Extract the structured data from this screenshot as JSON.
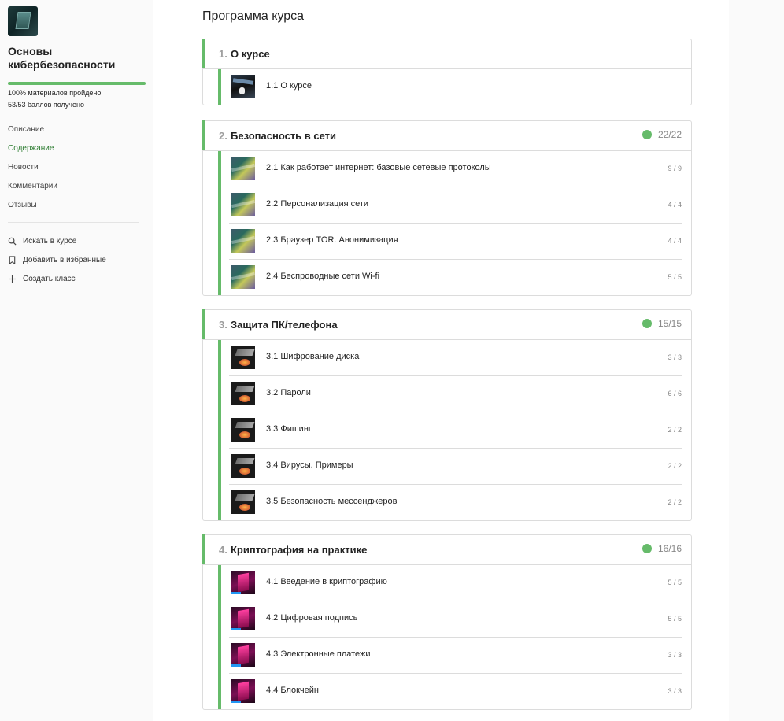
{
  "sidebar": {
    "course_title": "Основы кибербезопасности",
    "progress_fraction": 1.0,
    "progress_text": "100% материалов пройдено",
    "points_text": "53/53 баллов получено",
    "nav": [
      {
        "label": "Описание",
        "active": false
      },
      {
        "label": "Содержание",
        "active": true
      },
      {
        "label": "Новости",
        "active": false
      },
      {
        "label": "Комментарии",
        "active": false
      },
      {
        "label": "Отзывы",
        "active": false
      }
    ],
    "actions": [
      {
        "label": "Искать в курсе",
        "icon": "search-icon"
      },
      {
        "label": "Добавить в избранные",
        "icon": "bookmark-icon"
      },
      {
        "label": "Создать класс",
        "icon": "plus-icon"
      }
    ]
  },
  "main": {
    "title": "Программа курса",
    "accent_color": "#66bb6a",
    "sections": [
      {
        "number": "1.",
        "name": "О курсе",
        "score": "",
        "thumb": "security",
        "lessons": [
          {
            "label": "1.1 О курсе",
            "score": ""
          }
        ]
      },
      {
        "number": "2.",
        "name": "Безопасность в сети",
        "score": "22/22",
        "thumb": "net",
        "lessons": [
          {
            "label": "2.1 Как работает интернет: базовые сетевые протоколы",
            "score": "9 / 9"
          },
          {
            "label": "2.2 Персонализация сети",
            "score": "4 / 4"
          },
          {
            "label": "2.3 Браузер TOR. Анонимизация",
            "score": "4 / 4"
          },
          {
            "label": "2.4 Беспроводные сети Wi-fi",
            "score": "5 / 5"
          }
        ]
      },
      {
        "number": "3.",
        "name": "Защита ПК/телефона",
        "score": "15/15",
        "thumb": "pc",
        "lessons": [
          {
            "label": "3.1 Шифрование диска",
            "score": "3 / 3"
          },
          {
            "label": "3.2 Пароли",
            "score": "6 / 6"
          },
          {
            "label": "3.3 Фишинг",
            "score": "2 / 2"
          },
          {
            "label": "3.4 Вирусы. Примеры",
            "score": "2 / 2"
          },
          {
            "label": "3.5 Безопасность мессенджеров",
            "score": "2 / 2"
          }
        ]
      },
      {
        "number": "4.",
        "name": "Криптография на практике",
        "score": "16/16",
        "thumb": "crypto",
        "lessons": [
          {
            "label": "4.1 Введение в криптографию",
            "score": "5 / 5"
          },
          {
            "label": "4.2 Цифровая подпись",
            "score": "5 / 5"
          },
          {
            "label": "4.3 Электронные платежи",
            "score": "3 / 3"
          },
          {
            "label": "4.4 Блокчейн",
            "score": "3 / 3"
          }
        ]
      }
    ]
  }
}
